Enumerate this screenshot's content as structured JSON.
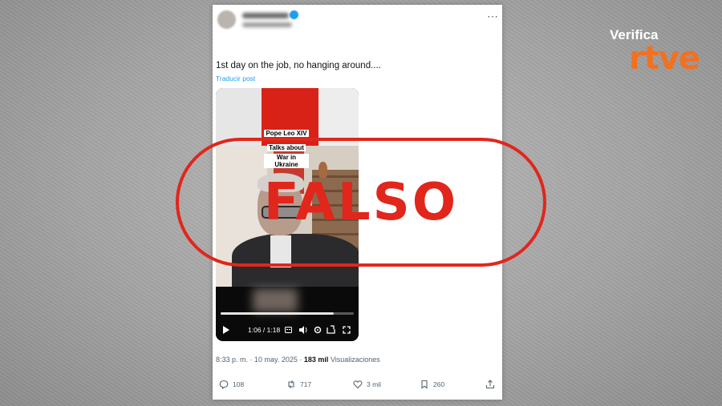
{
  "tweet": {
    "text": "1st day on the job, no hanging around....",
    "translate_link": "Traducir post",
    "timestamp": "8:33 p. m. · 10 may. 2025 · ",
    "views_count": "183 mil",
    "views_label": "Visualizaciones"
  },
  "video": {
    "caption_lines": [
      "Pope Leo XIV",
      "Talks about",
      "War in Ukraine"
    ],
    "time": "1:06 / 1:18",
    "progress": 0.85
  },
  "actions": {
    "replies": "108",
    "reposts": "717",
    "likes": "3 mil",
    "bookmarks": "260"
  },
  "overlay": {
    "stamp": "FALSO",
    "color": "#e1261c"
  },
  "logo": {
    "top": "Verifica",
    "bottom": "rtve",
    "color": "#f37021"
  },
  "colors": {
    "link": "#1d9bf0",
    "muted": "#536471"
  }
}
